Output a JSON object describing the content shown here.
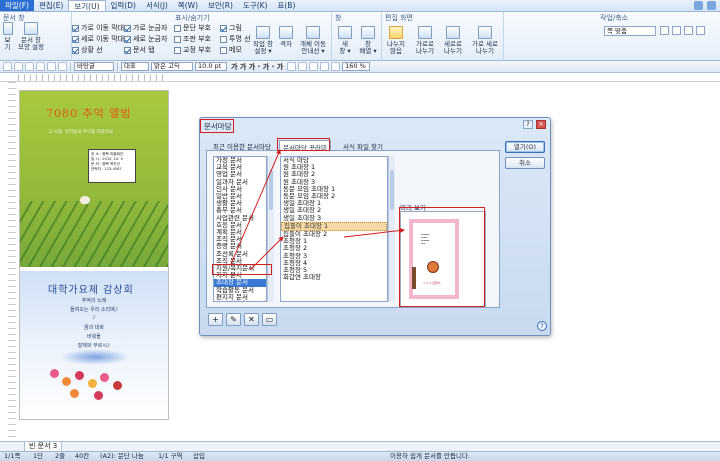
{
  "menu": {
    "app": "파일(F)",
    "tabs": [
      "편집(E)",
      "보기(U)",
      "입력(D)",
      "서식(J)",
      "쪽(W)",
      "보안(R)",
      "도구(K)",
      "표(B)"
    ]
  },
  "ribbon": {
    "groups": {
      "doc_view": "문서 창",
      "mark": "표시/숨기기",
      "editscreen": "편집 화면",
      "zoom": "작업/축소",
      "window": "창"
    },
    "buttons": {
      "doc_setting": "문서 창\n모양 설정",
      "view": "보기",
      "work_setting": "작업 창\n설정 ▾",
      "grid": "격자",
      "zoom_transform": "개체 이동\n안내선 ▾",
      "new_window": "새\n창 ▾",
      "cascade": "창\n배열 ▾",
      "split": "나누지\n않음",
      "hsplit": "가로로\n나누기",
      "vsplit": "세로로\n나누기",
      "hvsplit": "가로 세로\n나누기",
      "zoom_select": "쪽 맞춤"
    },
    "checks": [
      {
        "label": "가로 이동 막대",
        "on": true
      },
      {
        "label": "세로 이동 막대",
        "on": true
      },
      {
        "label": "상황 선",
        "on": true
      },
      {
        "label": "가로 눈금자",
        "on": true
      },
      {
        "label": "세로 눈금자",
        "on": true
      },
      {
        "label": "문서 탭",
        "on": true
      },
      {
        "label": "문단 부호",
        "on": false
      },
      {
        "label": "조판 부호",
        "on": false
      },
      {
        "label": "교정 부호",
        "on": false
      },
      {
        "label": "그림",
        "on": true
      },
      {
        "label": "투명 선",
        "on": false
      },
      {
        "label": "메모",
        "on": false
      }
    ]
  },
  "format_bar": {
    "style": "바탕글",
    "lang": "대표",
    "font": "맑은 고딕",
    "size": "10.0 pt",
    "bold_italic": "가 가 가 · 가 · 가",
    "zoom": "160 %"
  },
  "preview_card_green": {
    "title": "7080 추억 앨범",
    "sub": "그 시절, 우리들의 추억을 떠올려요",
    "lines": [
      "장 소 : 행복 마을회관",
      "일 시 : 2010. 10. 5",
      "문 의 : 행복 복지관",
      "연락처 : 123-4567"
    ]
  },
  "preview_card_blue": {
    "title": "대학가요제 감상회",
    "lines": [
      "추억의 노래",
      "들려오는 우리 소리에♪",
      "♪",
      "꿈의 대화",
      "바윗돌",
      "잘제와 부르시♪"
    ]
  },
  "dialog": {
    "title": "문서마당",
    "tabs": [
      "최근 이용한 문서마당",
      "문서마당 꾸러미",
      "서식 파일 찾기"
    ],
    "buttons": {
      "open": "열기(O)",
      "cancel": "취소"
    },
    "categories": [
      "가정 문서",
      "교육 문서",
      "영업 문서",
      "일과자 문서",
      "인사 문서",
      "일반 문서",
      "생활 문서",
      "총무 문서",
      "사업관련 문서",
      "호응 문서",
      "계획 문서",
      "조직 문서",
      "증명 문서",
      "조선록 문서",
      "조직 문서",
      "지원/복지문서",
      "지지 문서",
      "초대장 문서",
      "학습활동 문서",
      "편지지 문서",
      "프레젠테이션 문서",
      "한자 문서"
    ],
    "category_selected": 17,
    "templates": [
      "서식 마당",
      "원 초대장 1",
      "원 초대장 2",
      "원 초대장 3",
      "동문 모임 초대장 1",
      "동문 모임 초대장 2",
      "생일 초대장 1",
      "생일 초대장 2",
      "생일 초대장 3",
      "집들이 초대장 1",
      "집들이 초대장 2",
      "초청장 1",
      "초청장 2",
      "초청장 3",
      "초청장 4",
      "초청장 5",
      "회갑연 초대장"
    ],
    "template_selected": 9,
    "preview_label": "미리 보기",
    "preview_name": "ㅇㅇㅇ 집들이",
    "tools": [
      "+",
      "✎",
      "✕",
      "▭"
    ],
    "help": "?"
  },
  "doc_tab": "빈 문서 3",
  "status": {
    "page": "1/1쪽",
    "section": "1단",
    "line": "2줄",
    "col": "40칸",
    "style": "(A2): 문단 나눔",
    "layout": "1/1 구역",
    "mode": "삽입",
    "hint": "이용하 쉽게 문서를 만듭니다."
  }
}
